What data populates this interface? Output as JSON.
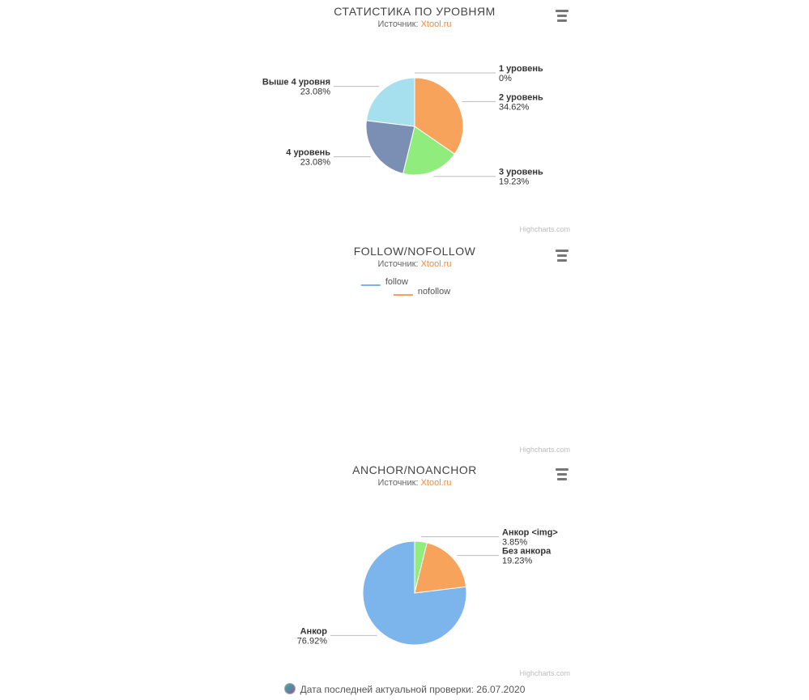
{
  "source_label": "Источник:",
  "source_name": "Xtool.ru",
  "credits": "Highcharts.com",
  "chart_data": [
    {
      "type": "pie",
      "title": "СТАТИСТИКА ПО УРОВНЯМ",
      "series": [
        {
          "name": "1 уровень",
          "value": 0.0,
          "pct_label": "0%",
          "color": "#7cb5ec"
        },
        {
          "name": "2 уровень",
          "value": 34.62,
          "pct_label": "34.62%",
          "color": "#f7a35c"
        },
        {
          "name": "3 уровень",
          "value": 19.23,
          "pct_label": "19.23%",
          "color": "#90ed7d"
        },
        {
          "name": "4 уровень",
          "value": 23.08,
          "pct_label": "23.08%",
          "color": "#7b8fb5"
        },
        {
          "name": "Выше 4 уровня",
          "value": 23.08,
          "pct_label": "23.08%",
          "color": "#a6e0ef"
        }
      ]
    },
    {
      "type": "pie",
      "title": "FOLLOW/NOFOLLOW",
      "legend_only": true,
      "series": [
        {
          "name": "follow",
          "value": null,
          "color": "#7cb5ec"
        },
        {
          "name": "nofollow",
          "value": null,
          "color": "#f7a35c"
        }
      ]
    },
    {
      "type": "pie",
      "title": "ANCHOR/NOANCHOR",
      "series": [
        {
          "name": "Анкор <img>",
          "value": 3.85,
          "pct_label": "3.85%",
          "color": "#90ed7d"
        },
        {
          "name": "Без анкора",
          "value": 19.23,
          "pct_label": "19.23%",
          "color": "#f7a35c"
        },
        {
          "name": "Анкор",
          "value": 76.92,
          "pct_label": "76.92%",
          "color": "#7cb5ec"
        }
      ]
    }
  ],
  "footer": "Дата последней актуальной проверки: 26.07.2020"
}
